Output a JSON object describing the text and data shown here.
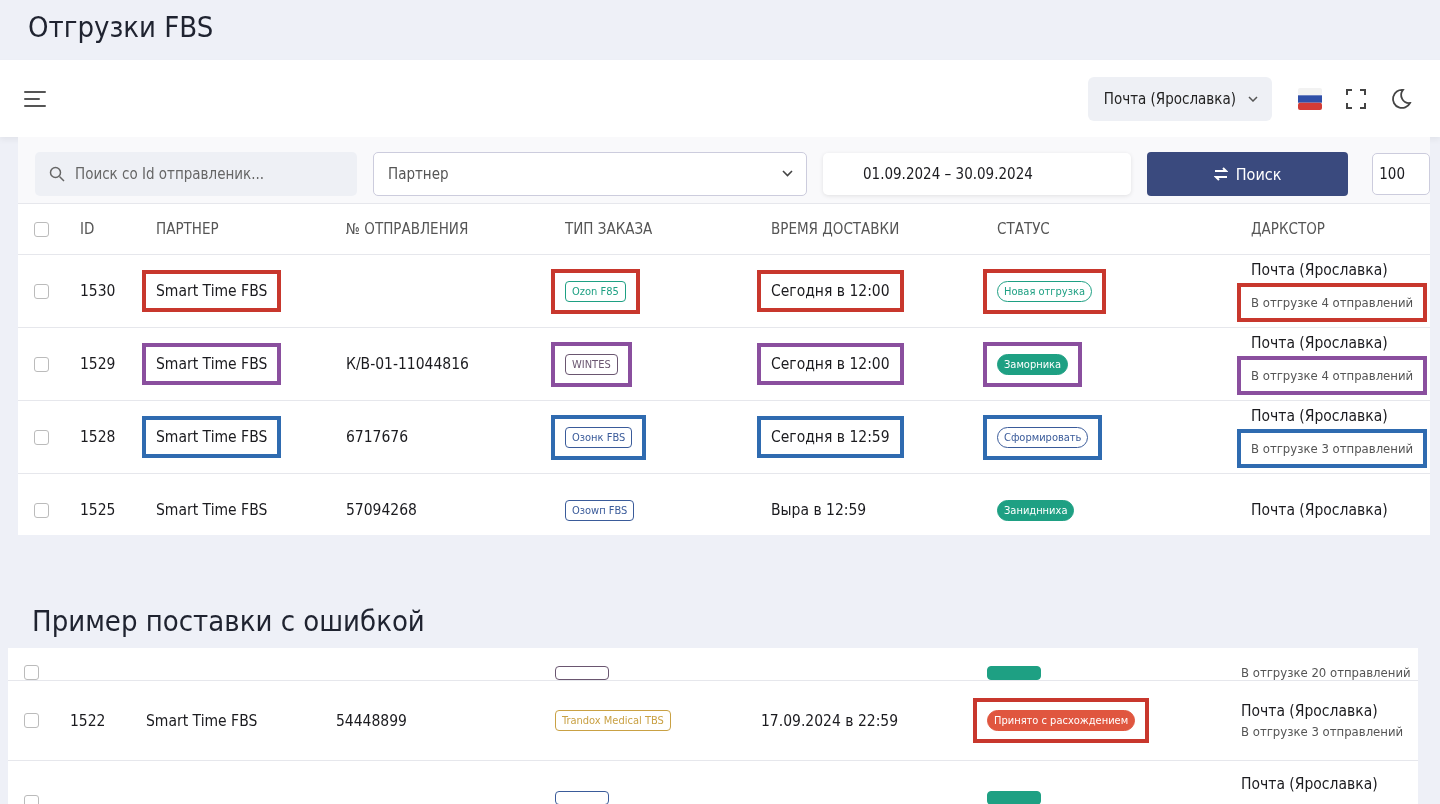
{
  "title": "Отгрузки FBS",
  "topbar": {
    "warehouse": "Почта (Ярославка)"
  },
  "filters": {
    "search": {
      "placeholder": "Поиск со Id отправленик..."
    },
    "partner": {
      "placeholder": "Партнер"
    },
    "dates": "01.09.2024 – 30.09.2024",
    "search_button": "Поиск",
    "page_size": "100"
  },
  "table": {
    "columns": [
      "ID",
      "ПАРТНЕР",
      "№ ОТПРАВЛЕНИЯ",
      "ТИП ЗАКАЗА",
      "ВРЕМЯ ДОСТАВКИ",
      "СТАТУС",
      "ДАРКСТОР"
    ],
    "rows": [
      {
        "id": "1530",
        "partner": "Smart Time FBS",
        "number": "",
        "type": {
          "label": "Ozon F85",
          "color": "#1ea083",
          "filled": false
        },
        "time": "Сегодня в 12:00",
        "status": {
          "label": "Новая отгрузка",
          "color": "#1ea083",
          "filled": false
        },
        "darkstore": "Почта (Ярославка)",
        "shipments": "В отгрузке 4 отправлений",
        "checked": false,
        "annotation": {
          "color": "#c8372d",
          "partner": true,
          "type": true,
          "time": true,
          "status": true,
          "shipments": true
        }
      },
      {
        "id": "1529",
        "partner": "Smart Time FBS",
        "number": "К/В-01-11044816",
        "type": {
          "label": "WINTES",
          "color": "#6a5670",
          "filled": false
        },
        "time": "Сегодня в 12:00",
        "status": {
          "label": "Заморника",
          "color": "#1ea083",
          "filled": true
        },
        "darkstore": "Почта (Ярославка)",
        "shipments": "В отгрузке 4 отправлений",
        "checked": false,
        "annotation": {
          "color": "#8a4f9e",
          "partner": true,
          "type": true,
          "time": true,
          "status": true,
          "shipments": true
        }
      },
      {
        "id": "1528",
        "partner": "Smart Time FBS",
        "number": "6717676",
        "type": {
          "label": "Озонк FBS",
          "color": "#3a5b9a",
          "filled": false
        },
        "time": "Сегодня в 12:59",
        "status": {
          "label": "Сформировать",
          "color": "#3a5b9a",
          "filled": false
        },
        "darkstore": "Почта (Ярославка)",
        "shipments": "В отгрузке 3 отправлений",
        "checked": false,
        "annotation": {
          "color": "#2f6bb0",
          "partner": true,
          "type": true,
          "time": true,
          "status": true,
          "shipments": true
        }
      },
      {
        "id": "1525",
        "partner": "Smart Time FBS",
        "number": "57094268",
        "type": {
          "label": "Озоwп FBS",
          "color": "#3a5b9a",
          "filled": false
        },
        "time": "Выра в 12:59",
        "status": {
          "label": "Заниднниха",
          "color": "#1ea083",
          "filled": true
        },
        "darkstore": "Почта (Ярославка)",
        "checked": false
      }
    ],
    "select_all_checked": false
  },
  "example": {
    "title": "Пример поставки с ошибкой",
    "rows": [
      {
        "type": {
          "color": "#6a5670",
          "filled": false
        },
        "status": {
          "color": "#1ea083",
          "filled": true
        },
        "shipments": "В отгрузке 20 отправлений",
        "checked": false
      },
      {
        "id": "1522",
        "partner": "Smart Time FBS",
        "number": "54448899",
        "type": {
          "label": "Trandox Medical TBS",
          "color": "#c9a144",
          "filled": false
        },
        "time": "17.09.2024 в 22:59",
        "status": {
          "label": "Принято с расхождением",
          "color": "#e0563f",
          "filled": true
        },
        "darkstore": "Почта (Ярославка)",
        "shipments": "В отгрузке 3 отправлений",
        "checked": false,
        "annotation": {
          "color": "#c8372d",
          "status": true
        }
      },
      {
        "type": {
          "color": "#3a5b9a",
          "filled": false
        },
        "status": {
          "color": "#1ea083",
          "filled": true
        },
        "darkstore": "Почта (Ярославка)",
        "checked": false
      }
    ]
  }
}
